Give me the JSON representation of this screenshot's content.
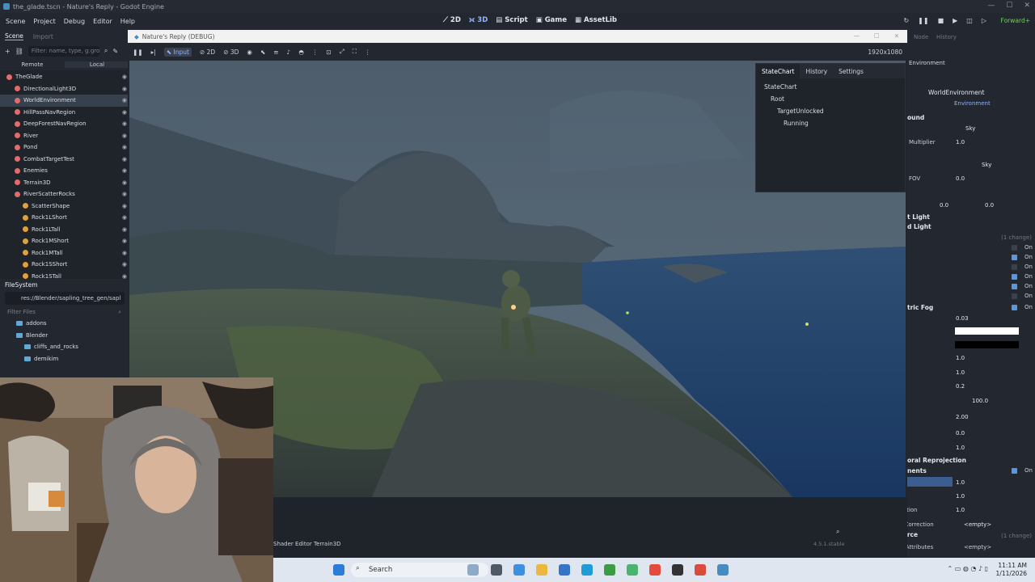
{
  "window": {
    "title": "the_glade.tscn - Nature's Reply - Godot Engine"
  },
  "menu": {
    "items": [
      "Scene",
      "Project",
      "Debug",
      "Editor",
      "Help"
    ],
    "workspaces": [
      "2D",
      "3D",
      "Script",
      "Game",
      "AssetLib"
    ],
    "renderer": "Forward+"
  },
  "scene_dock": {
    "tabs": [
      "Scene",
      "Import"
    ],
    "filter_placeholder": "Filter: name, type, g:gro",
    "remote": "Remote",
    "local": "Local",
    "nodes": [
      {
        "name": "TheGlade",
        "indent": 0,
        "color": "#e06c6c"
      },
      {
        "name": "DirectionalLight3D",
        "indent": 1,
        "color": "#e06c6c"
      },
      {
        "name": "WorldEnvironment",
        "indent": 1,
        "color": "#e06c6c",
        "selected": true
      },
      {
        "name": "HillPassNavRegion",
        "indent": 1,
        "color": "#e06c6c"
      },
      {
        "name": "DeepForestNavRegion",
        "indent": 1,
        "color": "#e06c6c"
      },
      {
        "name": "River",
        "indent": 1,
        "color": "#e06c6c"
      },
      {
        "name": "Pond",
        "indent": 1,
        "color": "#e06c6c"
      },
      {
        "name": "CombatTargetTest",
        "indent": 1,
        "color": "#e06c6c"
      },
      {
        "name": "Enemies",
        "indent": 1,
        "color": "#e06c6c"
      },
      {
        "name": "Terrain3D",
        "indent": 1,
        "color": "#e06c6c"
      },
      {
        "name": "RiverScatterRocks",
        "indent": 1,
        "color": "#e06c6c"
      },
      {
        "name": "ScatterShape",
        "indent": 2,
        "color": "#e0a03c"
      },
      {
        "name": "Rock1LShort",
        "indent": 2,
        "color": "#e0a03c"
      },
      {
        "name": "Rock1LTall",
        "indent": 2,
        "color": "#e0a03c"
      },
      {
        "name": "Rock1MShort",
        "indent": 2,
        "color": "#e0a03c"
      },
      {
        "name": "Rock1MTall",
        "indent": 2,
        "color": "#e0a03c"
      },
      {
        "name": "Rock1SShort",
        "indent": 2,
        "color": "#e0a03c"
      },
      {
        "name": "Rock1STall",
        "indent": 2,
        "color": "#e0a03c"
      }
    ]
  },
  "filesystem": {
    "title": "FileSystem",
    "path": "res://Blender/sapling_tree_gen/sapl",
    "filter_placeholder": "Filter Files",
    "items": [
      {
        "name": "addons",
        "indent": 1
      },
      {
        "name": "Blender",
        "indent": 1
      },
      {
        "name": "cliffs_and_rocks",
        "indent": 2
      },
      {
        "name": "demikim",
        "indent": 2
      }
    ]
  },
  "game_window": {
    "title": "Nature's Reply (DEBUG)",
    "toolbar": [
      "Input",
      "2D",
      "3D"
    ],
    "resolution": "1920x1080"
  },
  "statechart": {
    "tabs": [
      "StateChart",
      "History",
      "Settings"
    ],
    "nodes": [
      "StateChart",
      "Root",
      "TargetUnlocked",
      "Running"
    ]
  },
  "inspector": {
    "tabs": [
      "Node",
      "History"
    ],
    "header": "Environment",
    "node_name": "WorldEnvironment",
    "resource": "Environment",
    "rows": [
      {
        "label": "Sky",
        "value": "Sky"
      },
      {
        "label": "Multiplier",
        "value": "1.0"
      },
      {
        "label": "Sky",
        "value": "Sky"
      },
      {
        "label": "FOV",
        "value": "0.0"
      },
      {
        "label": "0.0",
        "value": "0.0"
      }
    ],
    "sections": [
      "ound",
      "t Light",
      "d Light",
      "tric Fog",
      "oral Reprojection",
      "nents"
    ],
    "fog": {
      "density": "0.03",
      "energy": "1.0",
      "v1": "1.0",
      "v2": "0.2",
      "length": "100.0",
      "spread": "2.00",
      "inject": "0.0",
      "v3": "1.0"
    },
    "adjust": {
      "v1": "1.0",
      "v2": "1.0",
      "saturation_label": "Saturation",
      "saturation": "1.0",
      "color_correction_label": "Color Correction",
      "color_correction": "<empty>"
    },
    "changes": "(1 change)",
    "resource_label": "Resource",
    "camera_attributes_label": "Camera Attributes",
    "camera_attributes": "<empty>",
    "on_label": "On"
  },
  "bottom": {
    "tabs": [
      "Shader Editor",
      "Terrain3D"
    ],
    "version": "4.5.1.stable"
  },
  "taskbar": {
    "search": "Search",
    "time": "11:11 AM",
    "date": "1/11/2026"
  }
}
